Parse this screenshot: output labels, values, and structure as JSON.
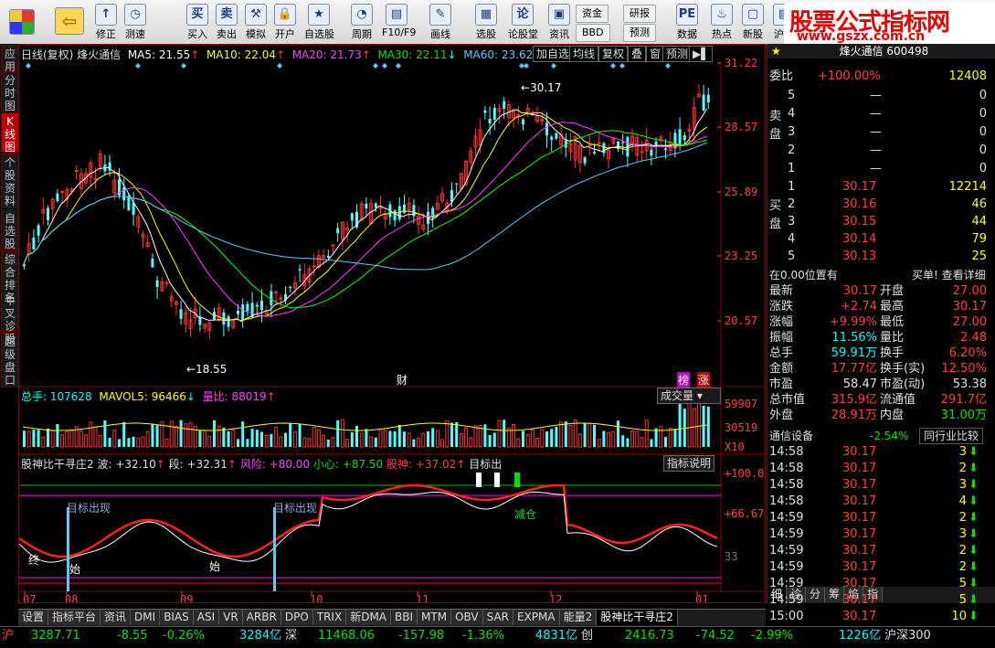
{
  "toolbar": {
    "buttons": [
      {
        "label": "修正",
        "icon": "↑"
      },
      {
        "label": "测速",
        "icon": "◷"
      },
      {
        "label": "买入",
        "icon": "买"
      },
      {
        "label": "卖出",
        "icon": "卖"
      },
      {
        "label": "模拟",
        "icon": "⚒"
      },
      {
        "label": "开户",
        "icon": "🔒"
      },
      {
        "label": "自选股",
        "icon": "★"
      },
      {
        "label": "周期",
        "icon": "◔"
      },
      {
        "label": "F10/F9",
        "icon": "▤"
      },
      {
        "label": "画线",
        "icon": "✎"
      },
      {
        "label": "选股",
        "icon": "▦"
      },
      {
        "label": "论股堂",
        "icon": "论"
      },
      {
        "label": "资讯",
        "icon": "▣"
      },
      {
        "label": "数据",
        "icon": "PE"
      },
      {
        "label": "热点",
        "icon": "♨"
      },
      {
        "label": "新股",
        "icon": "▢"
      },
      {
        "label": "沪港",
        "icon": "▤"
      }
    ],
    "small": {
      "fund": "资金",
      "research": "研报",
      "bbd": "BBD",
      "forecast": "预测"
    },
    "brand_title": "股票公式指标网",
    "brand_url": "www.gszx.com.cn"
  },
  "left_tabs": [
    "应用",
    "分时图",
    "K线图",
    "个股资料",
    "自选股",
    "综合排名",
    "牛叉诊股",
    "超级盘口"
  ],
  "chart_header": {
    "title": "日线(复权) 烽火通信",
    "ma5": "MA5: 21.55",
    "ma10": "MA10: 22.04",
    "ma20": "MA20: 21.73",
    "ma30": "MA30: 22.11",
    "ma60": "MA60: 23.62",
    "buttons": [
      "加自选",
      "均线",
      "复权",
      "叠",
      "窗",
      "预测"
    ],
    "price_high_label": "30.17",
    "price_low_label": "18.55",
    "tag_cai": "财",
    "tag_bang": "榜",
    "tag_zhang": "涨"
  },
  "price_axis": [
    "31.22",
    "28.57",
    "25.89",
    "23.25",
    "20.57"
  ],
  "volume_header": {
    "total": "总手: 107628",
    "mavol": "MAVOL5: 96466",
    "ratio": "量比: 88019",
    "dropdown": "成交量"
  },
  "volume_axis": [
    "59907",
    "30519",
    "X10"
  ],
  "indicator_header": {
    "name": "股神比干寻庄2",
    "wave": "波: +32.10",
    "seg": "段: +32.31",
    "risk": "风险: +80.00",
    "careful": "小心: +87.50",
    "danger": "股神: +37.02",
    "target": "目标出",
    "explain": "指标说明"
  },
  "indicator_axis": [
    "+100.0",
    "+66.67",
    "33"
  ],
  "indicator_labels": {
    "target1": "目标出现",
    "target2": "目标出现",
    "reduce": "减仓",
    "end": "终",
    "start": "始",
    "start2": "始"
  },
  "x_axis": [
    "07",
    "08",
    "09",
    "10",
    "11",
    "12",
    "01"
  ],
  "bottom_tabs": [
    "设置",
    "指标平台",
    "资讯",
    "DMI",
    "BIAS",
    "ASI",
    "VR",
    "ARBR",
    "DPO",
    "TRIX",
    "新DMA",
    "BBI",
    "MTM",
    "OBV",
    "SAR",
    "EXPMA",
    "能量2",
    "股神比干寻庄2"
  ],
  "right_panel": {
    "title": "烽火通信 600498",
    "weibi_label": "委比",
    "weibi_val": "+100.00%",
    "weibi_num": "12408",
    "sell": [
      {
        "n": "5",
        "p": "—",
        "v": "0"
      },
      {
        "n": "4",
        "p": "—",
        "v": "0"
      },
      {
        "n": "3",
        "p": "—",
        "v": "0"
      },
      {
        "n": "2",
        "p": "—",
        "v": "0"
      },
      {
        "n": "1",
        "p": "—",
        "v": "0"
      }
    ],
    "sell_label": "卖盘",
    "buy_label": "买盘",
    "buy": [
      {
        "n": "1",
        "p": "30.17",
        "v": "12214"
      },
      {
        "n": "2",
        "p": "30.16",
        "v": "46"
      },
      {
        "n": "3",
        "p": "30.15",
        "v": "44"
      },
      {
        "n": "4",
        "p": "30.14",
        "v": "79"
      },
      {
        "n": "5",
        "p": "30.13",
        "v": "25"
      }
    ],
    "position_left": "在0.00位置有",
    "position_right": "买单! 查看详细",
    "stats": [
      {
        "l": "最新",
        "v": "30.17",
        "l2": "开盘",
        "v2": "27.00"
      },
      {
        "l": "涨跌",
        "v": "+2.74",
        "l2": "最高",
        "v2": "30.17"
      },
      {
        "l": "涨幅",
        "v": "+9.99%",
        "l2": "最低",
        "v2": "27.00"
      },
      {
        "l": "振幅",
        "v": "11.56%",
        "l2": "量比",
        "v2": "2.48"
      },
      {
        "l": "总手",
        "v": "59.91万",
        "l2": "换手",
        "v2": "6.20%"
      },
      {
        "l": "金额",
        "v": "17.77亿",
        "l2": "换手(实)",
        "v2": "12.50%"
      },
      {
        "l": "市盈",
        "v": "58.47",
        "l2": "市盈(动)",
        "v2": "53.38"
      },
      {
        "l": "总市值",
        "v": "315.9亿",
        "l2": "流通值",
        "v2": "291.7亿"
      },
      {
        "l": "外盘",
        "v": "28.91万",
        "l2": "内盘",
        "v2": "31.00万"
      }
    ],
    "industry": "通信设备",
    "industry_change": "-2.54%",
    "industry_btn": "同行业比较",
    "ticks": [
      {
        "t": "14:58",
        "p": "30.17",
        "v": "3"
      },
      {
        "t": "14:58",
        "p": "30.17",
        "v": "2"
      },
      {
        "t": "14:58",
        "p": "30.17",
        "v": "3"
      },
      {
        "t": "14:58",
        "p": "30.17",
        "v": "4"
      },
      {
        "t": "14:59",
        "p": "30.17",
        "v": "2"
      },
      {
        "t": "14:59",
        "p": "30.17",
        "v": "3"
      },
      {
        "t": "14:59",
        "p": "30.17",
        "v": "2"
      },
      {
        "t": "14:59",
        "p": "30.17",
        "v": "2"
      },
      {
        "t": "14:59",
        "p": "30.17",
        "v": "5"
      },
      {
        "t": "14:59",
        "p": "30.17",
        "v": "5"
      },
      {
        "t": "15:00",
        "p": "30.17",
        "v": "10"
      }
    ],
    "tabs": [
      "细",
      "诊",
      "分",
      "筹",
      "焰",
      "指"
    ]
  },
  "status_bar": {
    "sh": "沪",
    "sh_idx": "3287.71",
    "sh_chg": "-8.55",
    "sh_pct": "-0.26%",
    "sh_amt": "3284亿",
    "sz": "深",
    "sz_idx": "11468.06",
    "sz_chg": "-157.98",
    "sz_pct": "-1.36%",
    "sz_amt": "4831亿",
    "cy": "创",
    "cy_idx": "2416.73",
    "cy_chg": "-74.52",
    "cy_pct": "-2.99%",
    "cy_amt": "1226亿",
    "hs": "沪深300"
  },
  "colors": {
    "up": "#ff3030",
    "down": "#54ffff",
    "ma5": "#ffffff",
    "ma10": "#ffff00",
    "ma20": "#ff40ff",
    "ma30": "#00ff00",
    "ma60": "#5fc9ff",
    "grid": "#8b0000"
  }
}
